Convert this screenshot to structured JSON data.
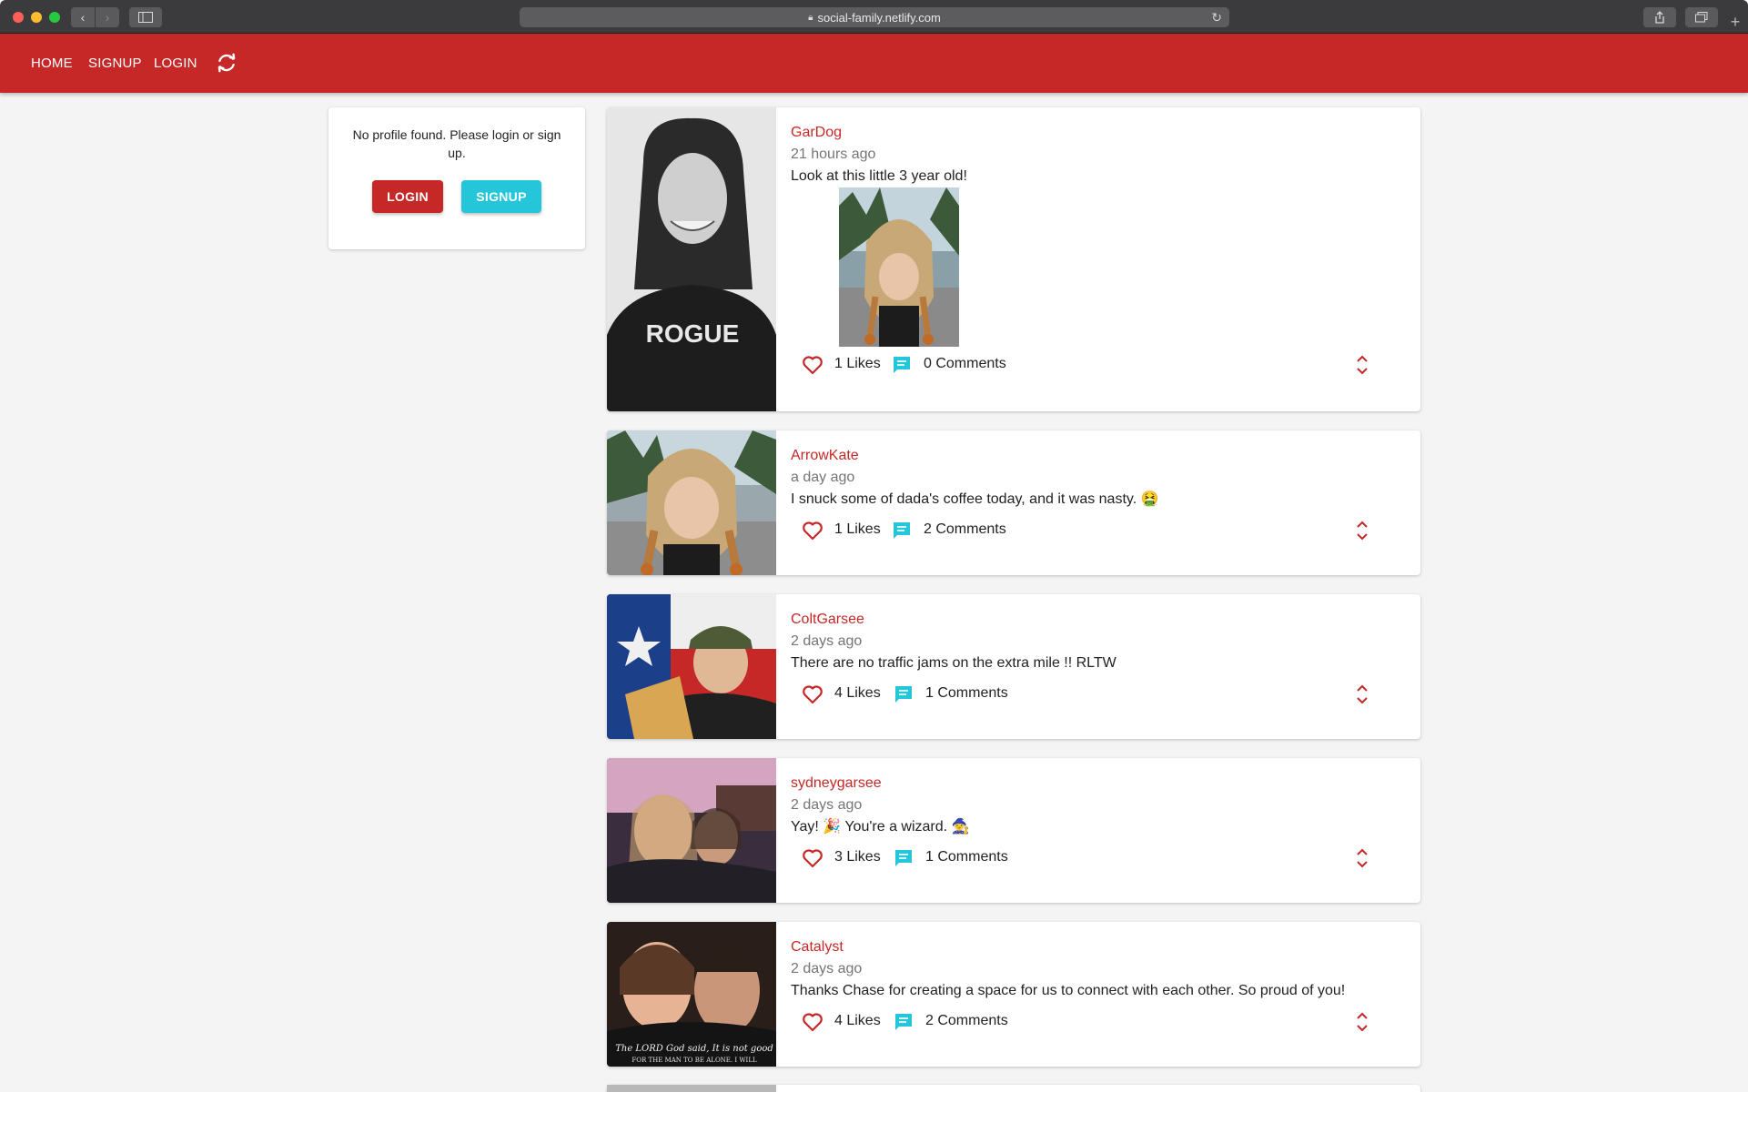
{
  "browser": {
    "url": "social-family.netlify.com"
  },
  "nav": {
    "home": "HOME",
    "signup": "SIGNUP",
    "login": "LOGIN",
    "brand_color": "#c62828"
  },
  "profile": {
    "message": "No profile found. Please login or sign up.",
    "login_label": "LOGIN",
    "signup_label": "SIGNUP",
    "signup_color": "#26c6da"
  },
  "posts": [
    {
      "username": "GarDog",
      "time": "21 hours ago",
      "body": "Look at this little 3 year old!",
      "likes": "1 Likes",
      "comments": "0 Comments",
      "has_image": true
    },
    {
      "username": "ArrowKate",
      "time": "a day ago",
      "body": "I snuck some of dada's coffee today, and it was nasty. 🤮",
      "likes": "1 Likes",
      "comments": "2 Comments"
    },
    {
      "username": "ColtGarsee",
      "time": "2 days ago",
      "body": "There are no traffic jams on the extra mile !! RLTW",
      "likes": "4 Likes",
      "comments": "1 Comments"
    },
    {
      "username": "sydneygarsee",
      "time": "2 days ago",
      "body": "Yay! 🎉 You're a wizard. 🧙",
      "likes": "3 Likes",
      "comments": "1 Comments"
    },
    {
      "username": "Catalyst",
      "time": "2 days ago",
      "body": "Thanks Chase for creating a space for us to connect with each other. So proud of you!",
      "likes": "4 Likes",
      "comments": "2 Comments"
    }
  ],
  "post_avatar_text": {
    "gardog_shirt": "ROGUE",
    "catalyst_caption_1": "The LORD God said, It is not good",
    "catalyst_caption_2": "FOR THE MAN TO BE ALONE. I WILL"
  }
}
